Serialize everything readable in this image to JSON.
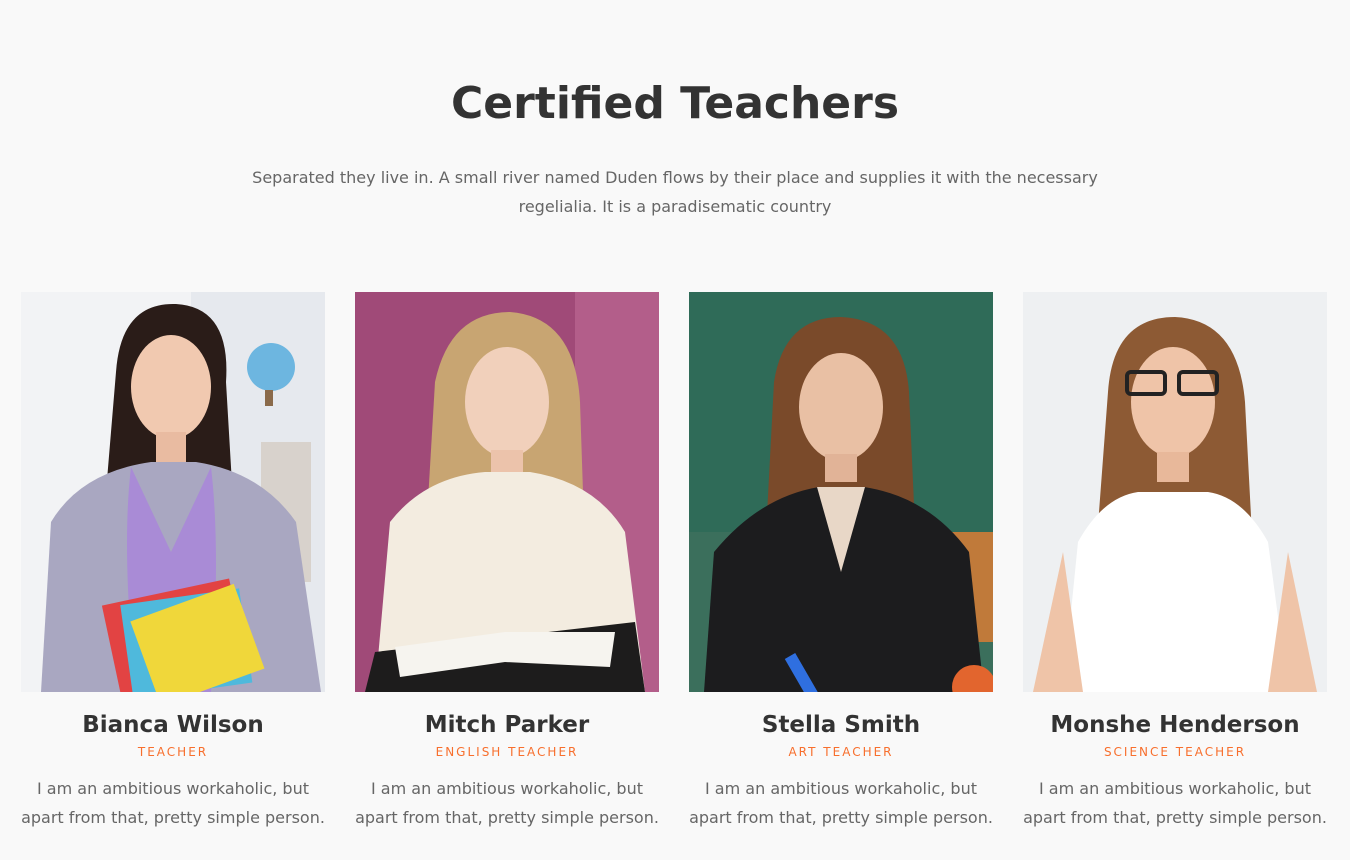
{
  "section": {
    "title": "Certified Teachers",
    "intro": "Separated they live in. A small river named Duden flows by their place and supplies it with the necessary regelialia. It is a paradisematic country"
  },
  "accent_color": "#f86f2d",
  "teachers": [
    {
      "name": "Bianca Wilson",
      "role": "TEACHER",
      "bio": "I am an ambitious workaholic, but apart from that, pretty simple person."
    },
    {
      "name": "Mitch Parker",
      "role": "ENGLISH TEACHER",
      "bio": "I am an ambitious workaholic, but apart from that, pretty simple person."
    },
    {
      "name": "Stella Smith",
      "role": "ART TEACHER",
      "bio": "I am an ambitious workaholic, but apart from that, pretty simple person."
    },
    {
      "name": "Monshe Henderson",
      "role": "SCIENCE TEACHER",
      "bio": "I am an ambitious workaholic, but apart from that, pretty simple person."
    }
  ]
}
